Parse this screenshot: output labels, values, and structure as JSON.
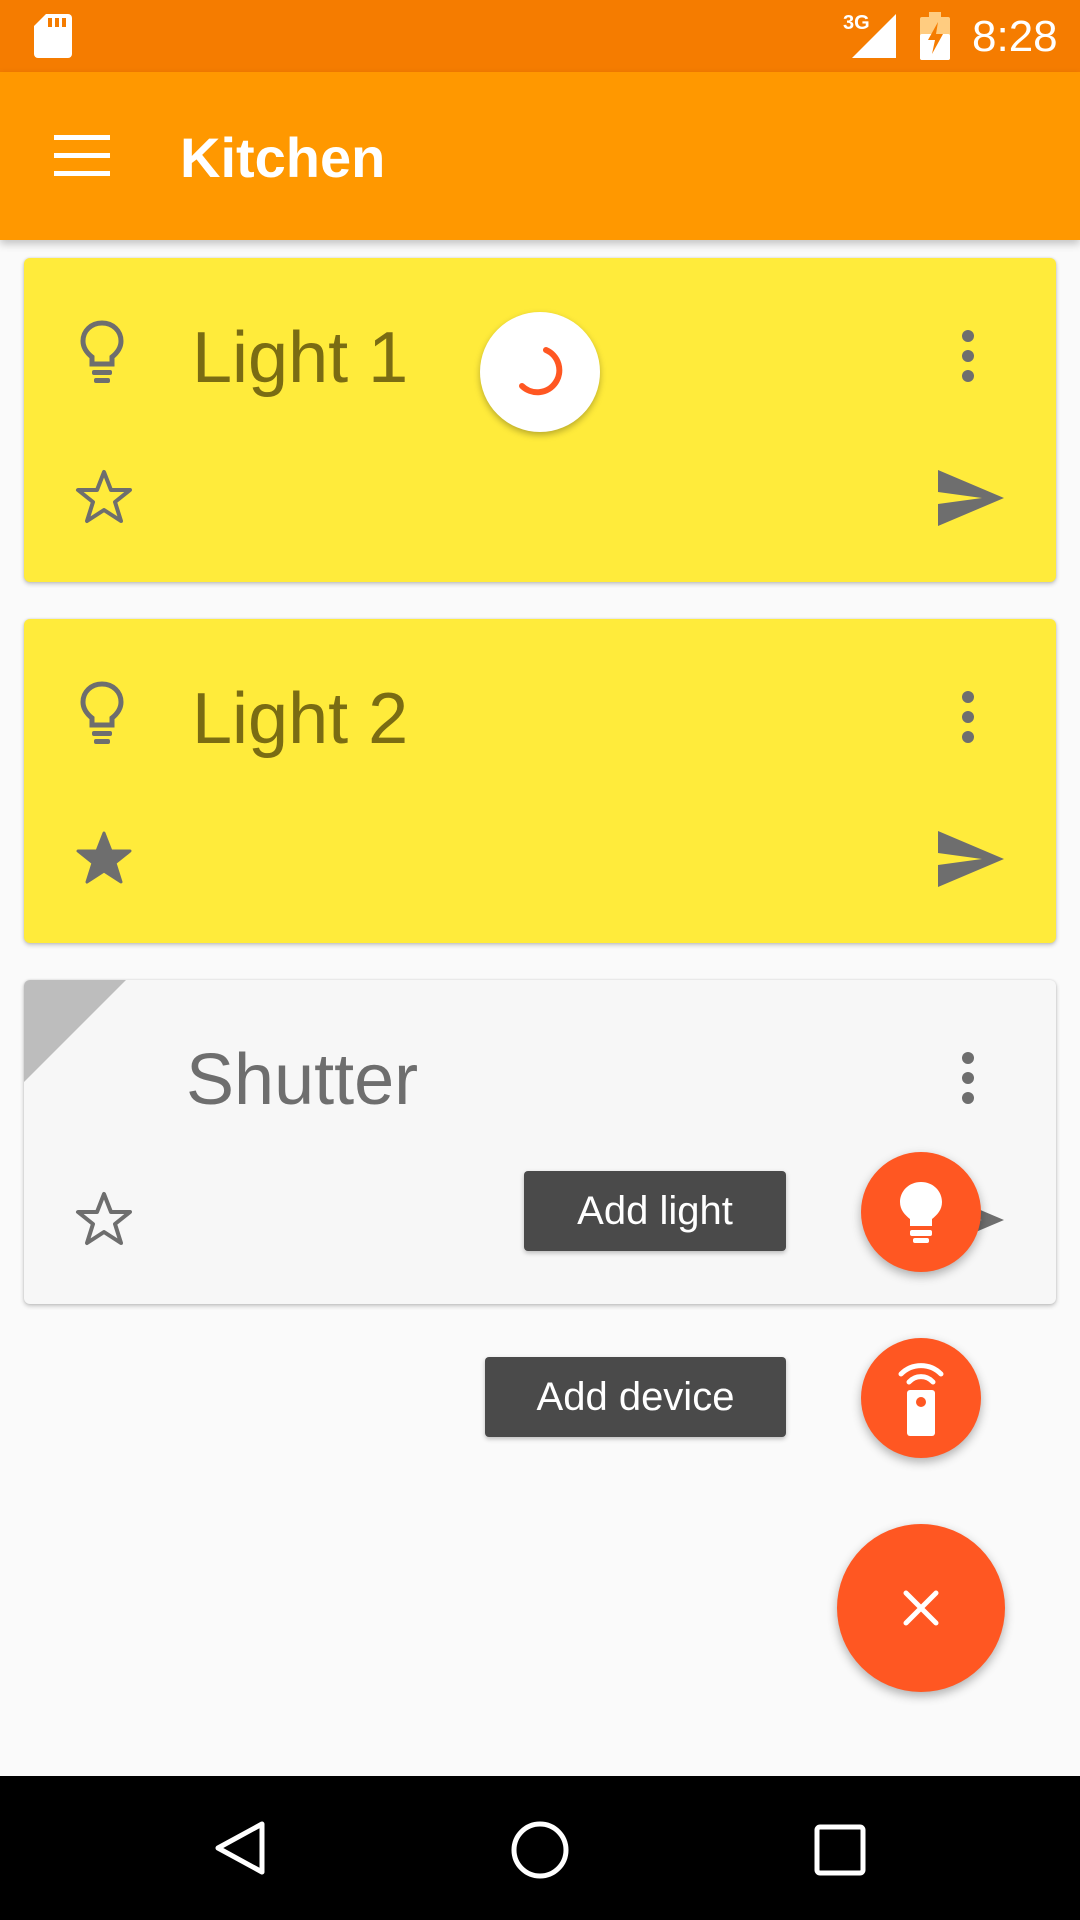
{
  "status_bar": {
    "network": "3G",
    "time": "8:28",
    "icons": [
      "sd-card-icon",
      "signal-icon",
      "battery-charging-icon"
    ]
  },
  "app_bar": {
    "title": "Kitchen",
    "menu_icon": "hamburger-menu-icon",
    "color": "#ff9800",
    "status_color": "#f57c00"
  },
  "devices": [
    {
      "name": "Light 1",
      "type": "light",
      "favorite": false,
      "state": "on",
      "loading": true
    },
    {
      "name": "Light 2",
      "type": "light",
      "favorite": true,
      "state": "on",
      "loading": false
    },
    {
      "name": "Shutter",
      "type": "shutter",
      "favorite": false,
      "state": "unknown",
      "loading": false
    }
  ],
  "speed_dial": {
    "add_light_label": "Add light",
    "add_device_label": "Add device",
    "add_light_icon": "lightbulb-icon",
    "add_device_icon": "remote-icon",
    "close_icon": "close-icon",
    "accent": "#ff5722"
  },
  "card_colors": {
    "on": "#ffeb3b",
    "off": "#f7f7f7"
  }
}
